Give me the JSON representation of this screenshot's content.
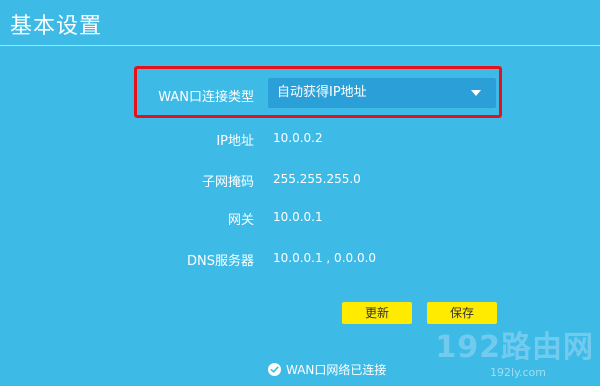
{
  "page": {
    "title": "基本设置"
  },
  "wan": {
    "type_label": "WAN口连接类型",
    "type_value": "自动获得IP地址",
    "ip_label": "IP地址",
    "ip_value": "10.0.0.2",
    "mask_label": "子网掩码",
    "mask_value": "255.255.255.0",
    "gateway_label": "网关",
    "gateway_value": "10.0.0.1",
    "dns_label": "DNS服务器",
    "dns_value": "10.0.0.1 , 0.0.0.0"
  },
  "actions": {
    "update_label": "更新",
    "save_label": "保存"
  },
  "status": {
    "text": "WAN口网络已连接",
    "icon": "check-circle-icon"
  },
  "watermark": {
    "text": "192路由网",
    "sub": "192ly.com"
  },
  "colors": {
    "background": "#3dbbe6",
    "select_bg": "#2b9fd8",
    "highlight_border": "#e3121b",
    "button_bg": "#ffeb00"
  }
}
